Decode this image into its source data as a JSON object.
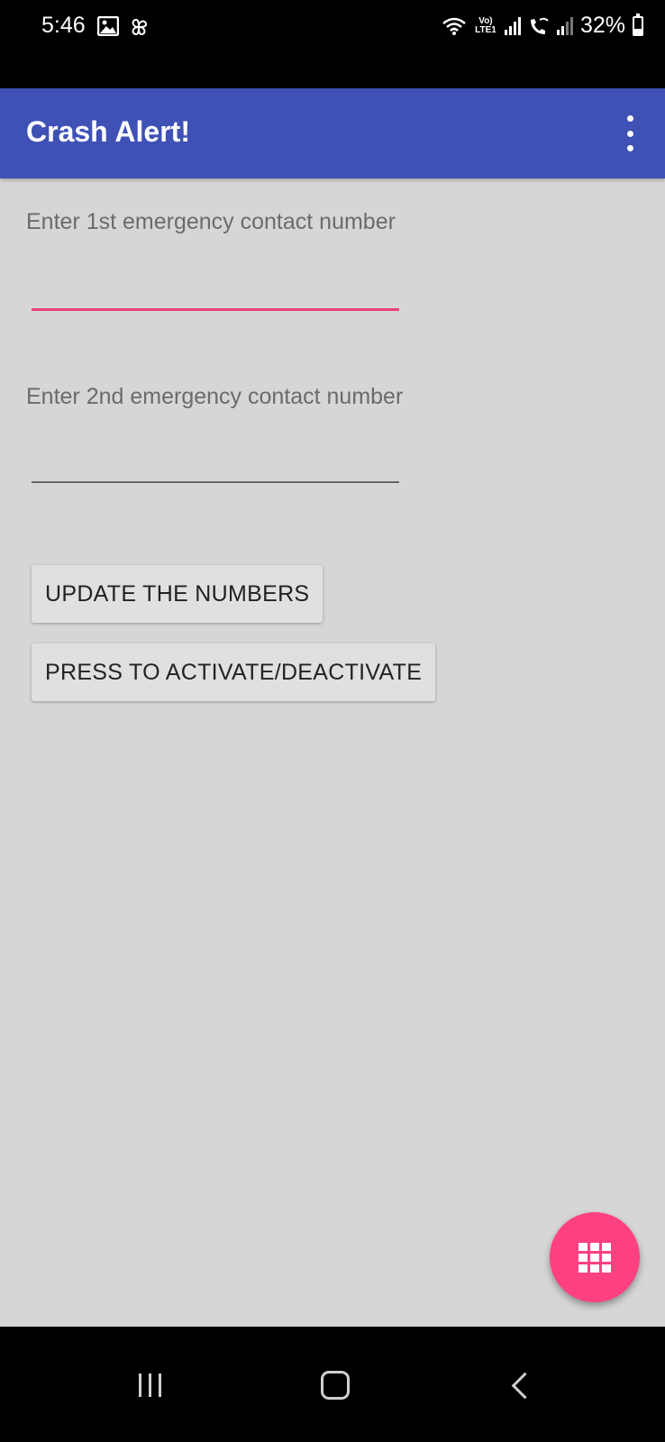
{
  "status_bar": {
    "time": "5:46",
    "network_label": "Vo) LTE1",
    "battery": "32%",
    "battery_level": 0.32,
    "icons": [
      "image-icon",
      "pinwheel-icon",
      "wifi-icon",
      "signal-icon",
      "wifi-calling-icon",
      "signal-icon",
      "battery-icon"
    ]
  },
  "app_bar": {
    "title": "Crash Alert!",
    "color": "#3f51b5",
    "menu_icon": "more-vert-icon"
  },
  "form": {
    "contact1_label": "Enter 1st emergency contact number",
    "contact1_value": "",
    "contact2_label": "Enter 2nd emergency contact number",
    "contact2_value": "",
    "focus_color": "#ec407a"
  },
  "buttons": {
    "update_label": "UPDATE THE NUMBERS",
    "activate_label": "PRESS TO ACTIVATE/DEACTIVATE"
  },
  "fab": {
    "icon": "dialpad-icon",
    "color": "#ff4081"
  },
  "nav_bar": {
    "icons": [
      "recents-icon",
      "home-icon",
      "back-icon"
    ]
  }
}
